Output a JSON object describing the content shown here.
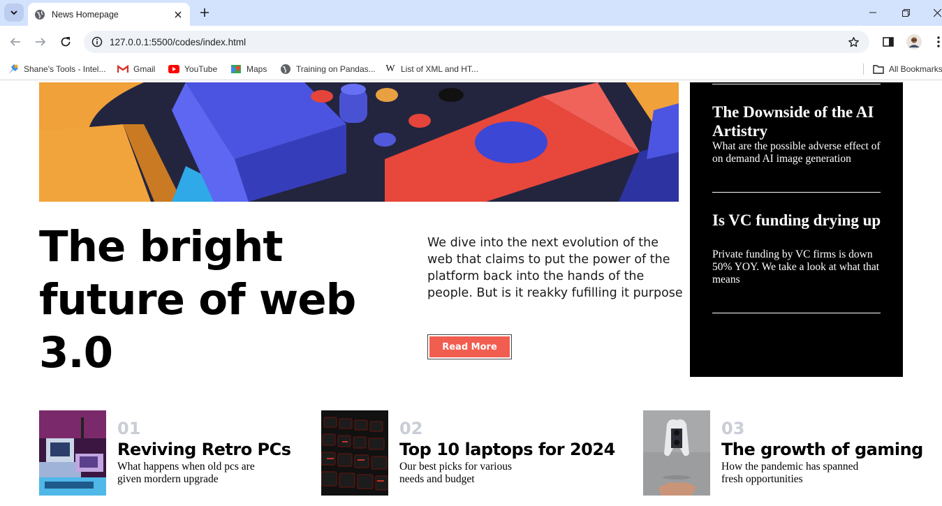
{
  "browser": {
    "tab_title": "News Homepage",
    "url": "127.0.0.1:5500/codes/index.html",
    "bookmarks": [
      {
        "label": "Shane's Tools - Intel...",
        "icon": "tools-icon"
      },
      {
        "label": "Gmail",
        "icon": "gmail-icon"
      },
      {
        "label": "YouTube",
        "icon": "youtube-icon"
      },
      {
        "label": "Maps",
        "icon": "maps-icon"
      },
      {
        "label": "Training on Pandas...",
        "icon": "globe-icon"
      },
      {
        "label": "List of XML and HT...",
        "icon": "wikipedia-icon"
      }
    ],
    "all_bookmarks_label": "All Bookmarks"
  },
  "hero": {
    "headline": "The bright future of web 3.0",
    "intro": "We dive into the next evolution of the web that claims to put the power of the platform back into the hands of the people. But is it reakky fufilling it purpose",
    "cta_label": "Read More"
  },
  "sidebar": {
    "items": [
      {
        "title": "The Downside of the AI Artistry",
        "text": "What are the possible adverse effect of on demand AI image generation"
      },
      {
        "title": "Is VC funding drying up",
        "text": "Private funding by VC firms is down 50% YOY. We take a look at what that means"
      }
    ]
  },
  "cards": [
    {
      "number": "01",
      "title": "Reviving Retro PCs",
      "text": "What happens when old pcs are given mordern upgrade"
    },
    {
      "number": "02",
      "title": "Top 10 laptops for 2024",
      "text": "Our best picks for various needs and budget"
    },
    {
      "number": "03",
      "title": "The growth of gaming",
      "text": "How the pandemic has spanned fresh opportunities"
    }
  ],
  "colors": {
    "accent": "#f15e50",
    "tabstrip": "#d3e3fd",
    "sidebar_bg": "#000000",
    "number": "#c9cdd6"
  }
}
